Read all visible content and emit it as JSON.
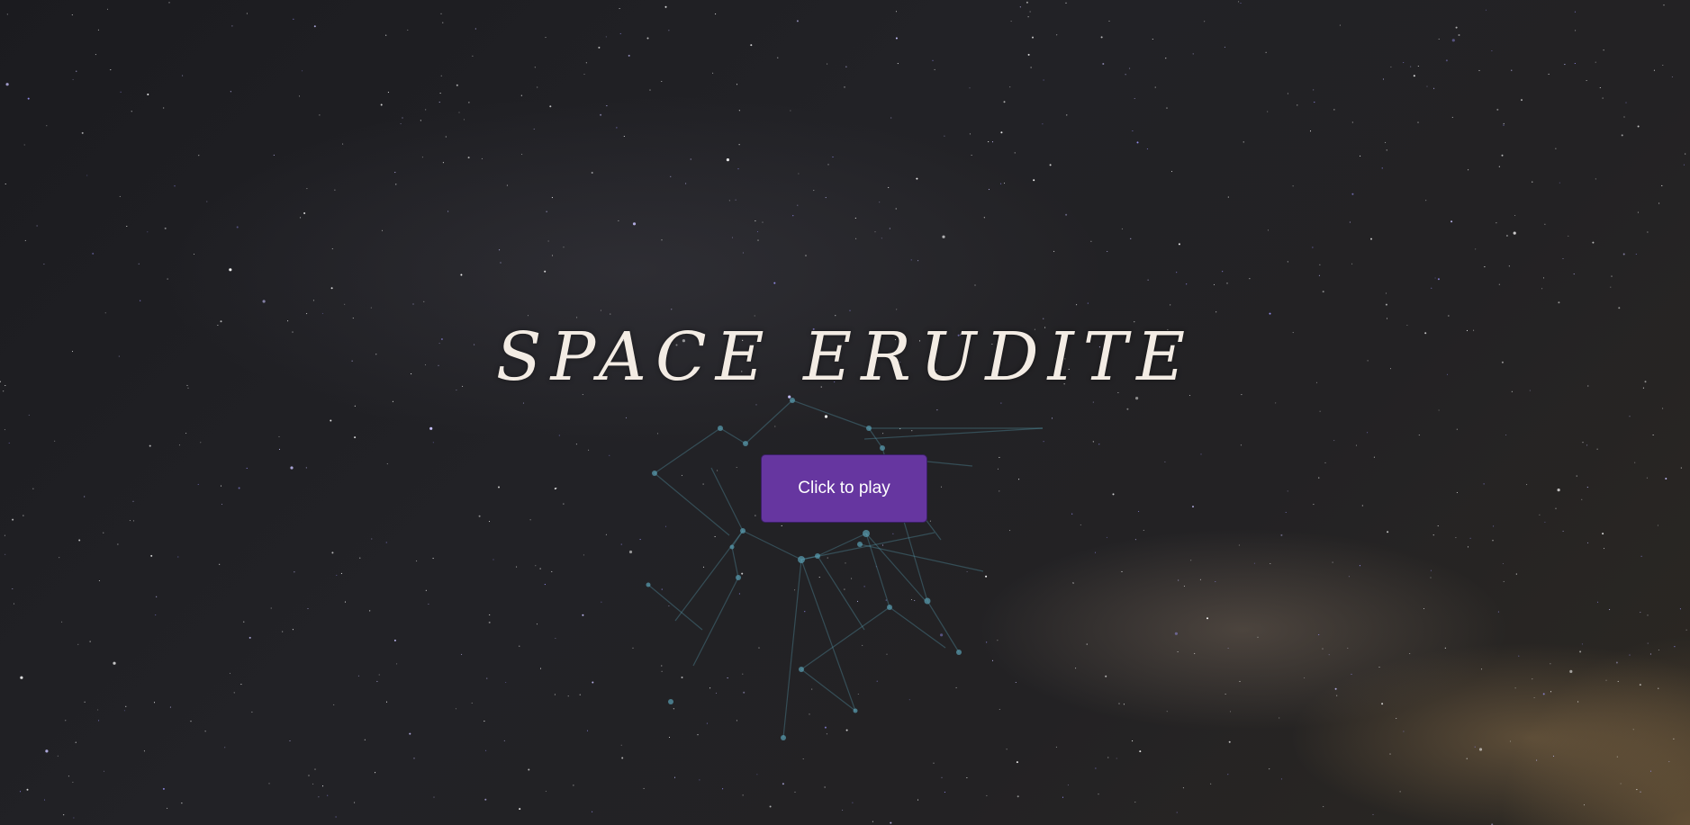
{
  "game": {
    "title": "SPACE ERUDITE",
    "play_button_label": "Click to play"
  },
  "colors": {
    "button_background": "#6636a0",
    "title_text": "#f3ece4",
    "network_lines": "#5aa0b4"
  }
}
